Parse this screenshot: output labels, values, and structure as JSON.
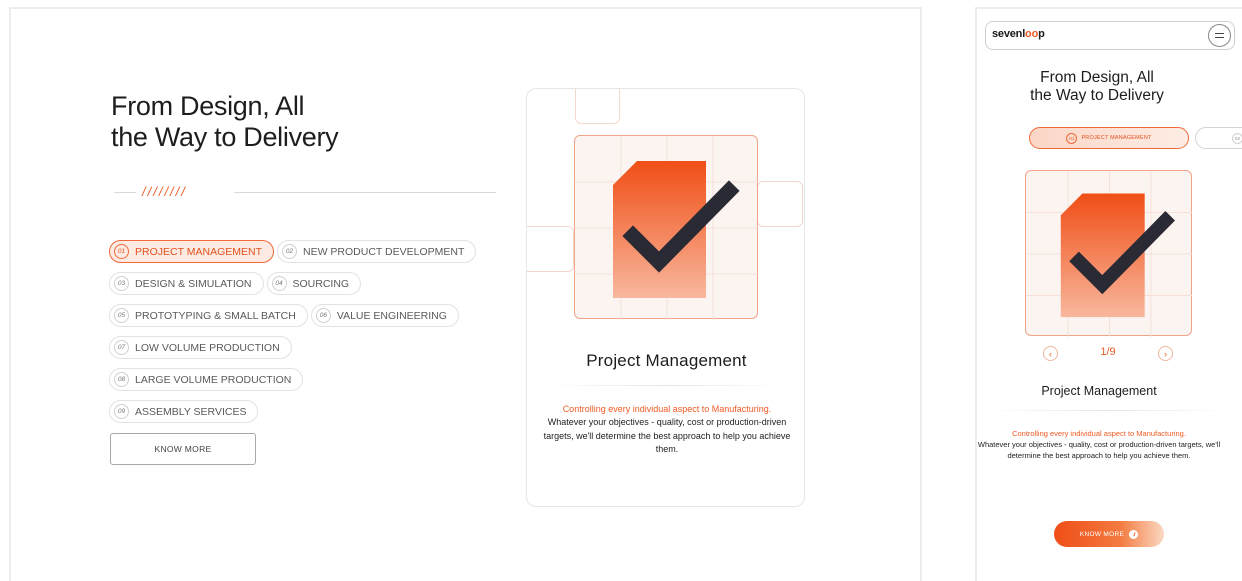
{
  "desktop": {
    "title": "From Design, All\nthe Way to Delivery",
    "divider_slashes": "////////",
    "services": [
      {
        "num": "01",
        "label": "PROJECT MANAGEMENT",
        "active": true
      },
      {
        "num": "02",
        "label": "NEW PRODUCT DEVELOPMENT",
        "active": false
      },
      {
        "num": "03",
        "label": "DESIGN & SIMULATION",
        "active": false
      },
      {
        "num": "04",
        "label": "SOURCING",
        "active": false
      },
      {
        "num": "05",
        "label": "PROTOTYPING & SMALL BATCH",
        "active": false
      },
      {
        "num": "06",
        "label": "VALUE ENGINEERING",
        "active": false
      },
      {
        "num": "07",
        "label": "LOW VOLUME PRODUCTION",
        "active": false
      },
      {
        "num": "08",
        "label": "LARGE VOLUME PRODUCTION",
        "active": false
      },
      {
        "num": "09",
        "label": "ASSEMBLY SERVICES",
        "active": false
      }
    ],
    "know_more_label": "KNOW MORE",
    "card": {
      "title": "Project Management",
      "accent": "Controlling every individual aspect to Manufacturing.",
      "description": "Whatever your objectives - quality, cost or production-driven targets, we'll determine the best approach to help you achieve them."
    }
  },
  "mobile": {
    "logo_prefix": "sevenl",
    "logo_oo": "oo",
    "logo_suffix": "p",
    "title": "From Design, All\nthe Way to Delivery",
    "active_chip": {
      "num": "01",
      "label": "PROJECT MANAGEMENT"
    },
    "next_chip_num": "02",
    "pager": "1/9",
    "card_title": "Project Management",
    "accent": "Controlling every individual aspect to Manufacturing.",
    "description": "Whatever your objectives - quality, cost or production-driven targets, we'll determine the best approach to help you achieve them.",
    "know_more_label": "KNOW MORE"
  },
  "colors": {
    "accent": "#ef5a24",
    "accent_light": "#fdebe3",
    "dark_check": "#2a2a35"
  },
  "icons": {
    "illustration": "document-check-icon",
    "menu": "hamburger-icon",
    "prev": "chevron-left-icon",
    "next": "chevron-right-icon"
  }
}
